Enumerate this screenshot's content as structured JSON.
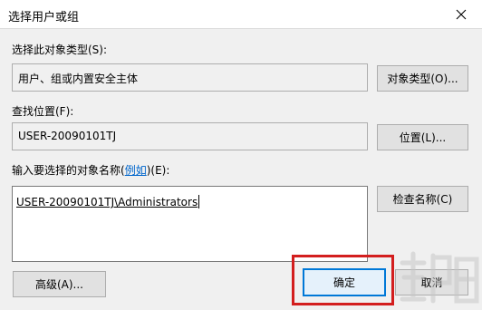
{
  "window": {
    "title": "选择用户或组"
  },
  "object_type": {
    "label": "选择此对象类型(S):",
    "value": "用户、组或内置安全主体",
    "button": "对象类型(O)..."
  },
  "location": {
    "label": "查找位置(F):",
    "value": "USER-20090101TJ",
    "button": "位置(L)..."
  },
  "names": {
    "label_prefix": "输入要选择的对象名称(",
    "label_link": "例如",
    "label_suffix": ")(E):",
    "value": "USER-20090101TJ\\Administrators",
    "check_button": "检查名称(C)"
  },
  "footer": {
    "advanced_button": "高级(A)...",
    "ok_button": "确定",
    "cancel_button": "取消"
  },
  "colors": {
    "highlight": "#d31e1e",
    "default_button_border": "#0078d7"
  }
}
